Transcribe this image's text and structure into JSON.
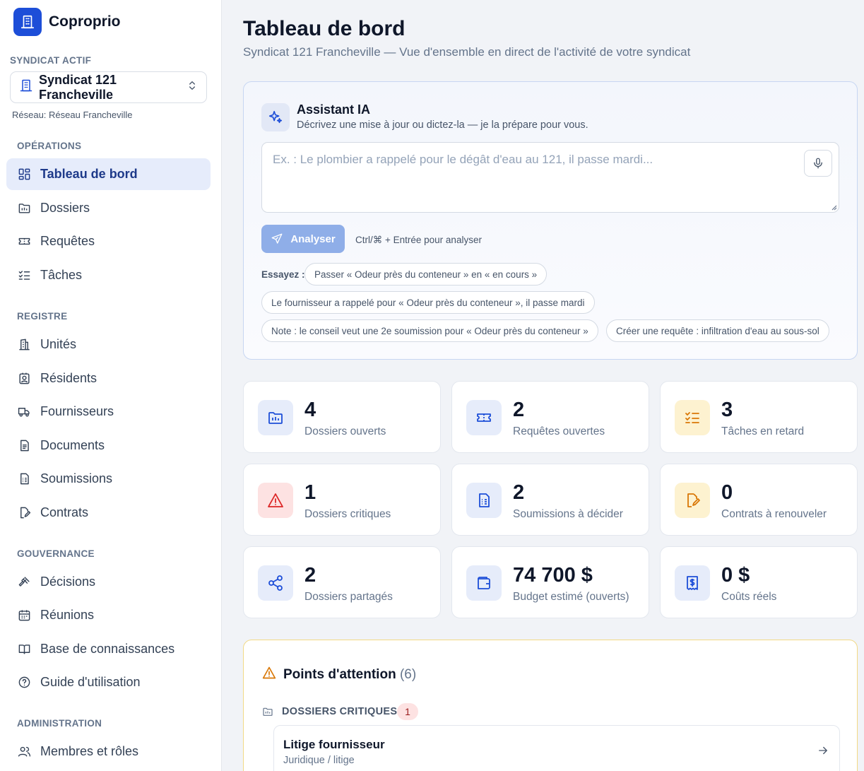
{
  "app": {
    "name": "Coproprio"
  },
  "sidebar": {
    "syndicat_label": "SYNDICAT ACTIF",
    "syndicat_name": "Syndicat 121 Francheville",
    "network": "Réseau: Réseau Francheville",
    "sections": [
      {
        "label": "OPÉRATIONS",
        "items": [
          {
            "label": "Tableau de bord",
            "icon": "dashboard-icon",
            "active": true
          },
          {
            "label": "Dossiers",
            "icon": "folder-icon"
          },
          {
            "label": "Requêtes",
            "icon": "ticket-icon"
          },
          {
            "label": "Tâches",
            "icon": "checklist-icon"
          }
        ]
      },
      {
        "label": "REGISTRE",
        "items": [
          {
            "label": "Unités",
            "icon": "building-icon"
          },
          {
            "label": "Résidents",
            "icon": "resident-icon"
          },
          {
            "label": "Fournisseurs",
            "icon": "truck-icon"
          },
          {
            "label": "Documents",
            "icon": "document-icon"
          },
          {
            "label": "Soumissions",
            "icon": "quote-icon"
          },
          {
            "label": "Contrats",
            "icon": "contract-icon"
          }
        ]
      },
      {
        "label": "GOUVERNANCE",
        "items": [
          {
            "label": "Décisions",
            "icon": "gavel-icon"
          },
          {
            "label": "Réunions",
            "icon": "calendar-icon"
          },
          {
            "label": "Base de connaissances",
            "icon": "book-icon"
          },
          {
            "label": "Guide d'utilisation",
            "icon": "help-icon"
          }
        ]
      },
      {
        "label": "ADMINISTRATION",
        "items": [
          {
            "label": "Membres et rôles",
            "icon": "users-icon"
          }
        ]
      }
    ]
  },
  "header": {
    "title": "Tableau de bord",
    "subtitle": "Syndicat 121 Francheville — Vue d'ensemble en direct de l'activité de votre syndicat"
  },
  "assistant": {
    "title": "Assistant IA",
    "description": "Décrivez une mise à jour ou dictez-la — je la prépare pour vous.",
    "placeholder": "Ex. : Le plombier a rappelé pour le dégât d'eau au 121, il passe mardi...",
    "value": "",
    "analyze_label": "Analyser",
    "hint": "Ctrl/⌘ + Entrée pour analyser",
    "try_label": "Essayez :",
    "suggestions": [
      "Passer « Odeur près du conteneur » en « en cours »",
      "Le fournisseur a rappelé pour « Odeur près du conteneur », il passe mardi",
      "Note : le conseil veut une 2e soumission pour « Odeur près du conteneur »",
      "Créer une requête : infiltration d'eau au sous-sol"
    ]
  },
  "stats": [
    {
      "value": "4",
      "label": "Dossiers ouverts",
      "icon": "folder-icon",
      "color": "#1d4ed8"
    },
    {
      "value": "2",
      "label": "Requêtes ouvertes",
      "icon": "ticket-icon",
      "color": "#1d4ed8"
    },
    {
      "value": "3",
      "label": "Tâches en retard",
      "icon": "checklist-icon",
      "color": "#d97706"
    },
    {
      "value": "1",
      "label": "Dossiers critiques",
      "icon": "alert-icon",
      "color": "#dc2626"
    },
    {
      "value": "2",
      "label": "Soumissions à décider",
      "icon": "quote-icon",
      "color": "#1d4ed8"
    },
    {
      "value": "0",
      "label": "Contrats à renouveler",
      "icon": "contract-icon",
      "color": "#d97706"
    },
    {
      "value": "2",
      "label": "Dossiers partagés",
      "icon": "share-icon",
      "color": "#1d4ed8"
    },
    {
      "value": "74 700 $",
      "label": "Budget estimé (ouverts)",
      "icon": "wallet-icon",
      "color": "#1d4ed8"
    },
    {
      "value": "0 $",
      "label": "Coûts réels",
      "icon": "receipt-icon",
      "color": "#1d4ed8"
    }
  ],
  "attention": {
    "title": "Points d'attention",
    "count": "(6)",
    "critical_label": "DOSSIERS CRITIQUES",
    "critical_count": "1",
    "items": [
      {
        "title": "Litige fournisseur",
        "category": "Juridique / litige"
      }
    ]
  },
  "colors": {
    "primary": "#1d4ed8",
    "accent_light": "#e6ecfb",
    "warning": "#d97706",
    "danger": "#dc2626"
  }
}
